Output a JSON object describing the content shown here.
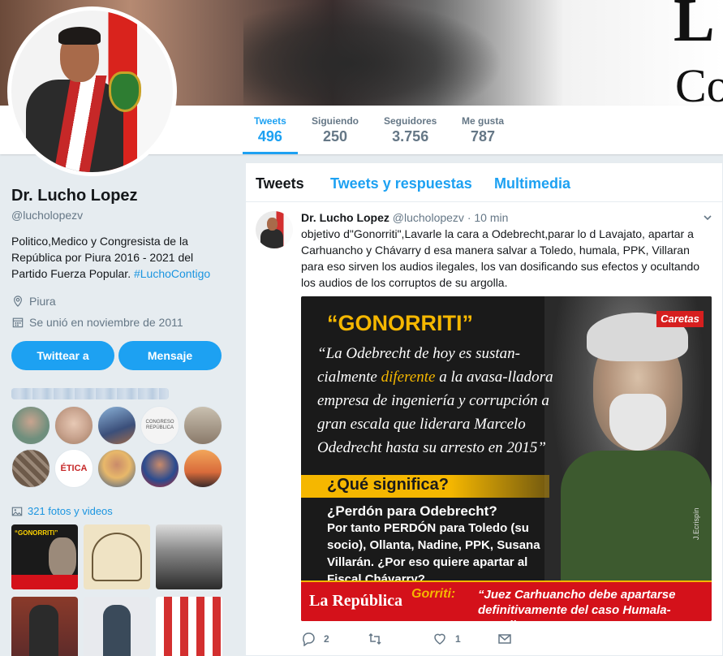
{
  "profile": {
    "name": "Dr. Lucho Lopez",
    "handle": "@lucholopezv",
    "bio": "Politico,Medico y Congresista de la República por Piura 2016 - 2021 del Partido Fuerza Popular.",
    "bio_tag": "#LuchoContigo",
    "location": "Piura",
    "joined": "Se unió en noviembre de 2011",
    "tweet_to_label": "Twittear a",
    "message_label": "Mensaje",
    "photos_label": "321 fotos y videos"
  },
  "banner": {
    "letter_top": "L",
    "letter_bottom": "Co"
  },
  "stats": [
    {
      "label": "Tweets",
      "value": "496"
    },
    {
      "label": "Siguiendo",
      "value": "250"
    },
    {
      "label": "Seguidores",
      "value": "3.756"
    },
    {
      "label": "Me gusta",
      "value": "787"
    }
  ],
  "followers_you_know": [
    {
      "color": "#6f8f7d"
    },
    {
      "color": "#c9a48f"
    },
    {
      "color": "#3b4f7a"
    },
    {
      "text": "CONGRESO REPÚBLICA",
      "color": "#f4f4f4"
    },
    {
      "color": "#8a7a6a"
    },
    {
      "color": "#6d5a4a"
    },
    {
      "text": "ÉTICA",
      "color": "#ffffff"
    },
    {
      "color": "#e8b86a"
    },
    {
      "color": "#2a4b8f"
    },
    {
      "color": "#d96b3b"
    }
  ],
  "timeline_tabs": [
    "Tweets",
    "Tweets y respuestas",
    "Multimedia"
  ],
  "tweet": {
    "name": "Dr. Lucho Lopez",
    "handle": "@lucholopezv",
    "time": "· 10 min",
    "text": "objetivo d\"Gonorriti\",Lavarle la cara a Odebrecht,parar lo d Lavajato, apartar a Carhuancho y Chávarry d esa manera salvar a Toledo, humala, PPK,  Villaran para eso sirven los audios ilegales, los van dosificando  sus efectos y ocultando los audios de los corruptos de su argolla.",
    "replies": "2",
    "retweets": "",
    "likes": "1"
  },
  "tweet_image": {
    "brand": "Caretas",
    "title": "“GONORRITI”",
    "quote_pre": "“La Odebrecht de hoy es sustan-cialmente ",
    "quote_hl": "diferente",
    "quote_post": " a la avasa-lladora empresa de ingeniería y corrupción a gran escala que liderara Marcelo Odedrecht hasta su arresto en 2015”",
    "question": "¿Qué significa?",
    "answer_q": "¿Perdón para Odebrecht?",
    "answer_body": "Por tanto PERDÓN para Toledo (su socio), Ollanta, Nadine, PPK, Susana Villarán. ¿Por eso quiere apartar al Fiscal Chávarry?",
    "credit": "J.Ecrispín",
    "paper": "La República",
    "gorriti": "Gorriti:",
    "headline": "“Juez Carhuancho debe apartarse definitivamente del caso Humala-Heredia”"
  },
  "colors": {
    "accent": "#1da1f2",
    "link": "#1b95e0",
    "muted": "#657786",
    "background": "#e6ecf0"
  },
  "icons": {
    "location": "map-pin-icon",
    "joined": "calendar-icon",
    "photos": "image-icon",
    "reply": "reply-icon",
    "retweet": "retweet-icon",
    "like": "heart-icon",
    "dm": "envelope-icon",
    "caret": "chevron-down-icon"
  }
}
